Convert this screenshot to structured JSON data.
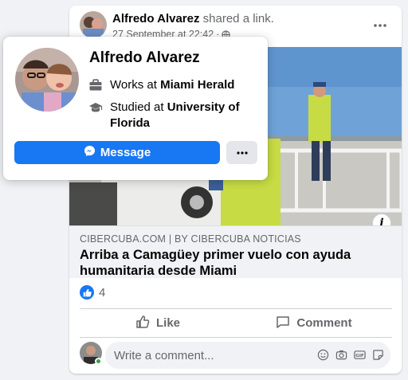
{
  "post": {
    "author": "Alfredo Alvarez",
    "action": "shared a link.",
    "timestamp": "27 September at 22:42",
    "privacy_icon": "globe-icon",
    "more_icon": "more-horizontal-icon",
    "link": {
      "domain": "CIBERCUBA.COM | BY CIBERCUBA NOTICIAS",
      "title": "Arriba a Camagüey primer vuelo con ayuda humanitaria desde Miami",
      "info_label": "i"
    },
    "reactions": {
      "icon": "like-reaction-icon",
      "count": "4"
    },
    "actions": {
      "like_label": "Like",
      "comment_label": "Comment"
    },
    "comment_box": {
      "placeholder": "Write a comment...",
      "icons": [
        "emoji-icon",
        "camera-icon",
        "gif-icon",
        "sticker-icon"
      ]
    }
  },
  "hovercard": {
    "name": "Alfredo Alvarez",
    "work_prefix": "Works at ",
    "work_place": "Miami Herald",
    "edu_prefix": "Studied at ",
    "edu_place": "University of Florida",
    "message_label": "Message",
    "message_icon": "messenger-icon",
    "more_icon": "more-horizontal-icon"
  },
  "colors": {
    "accent": "#1877f2",
    "background": "#f0f2f5",
    "secondary_text": "#65676b",
    "online": "#31a24c"
  }
}
